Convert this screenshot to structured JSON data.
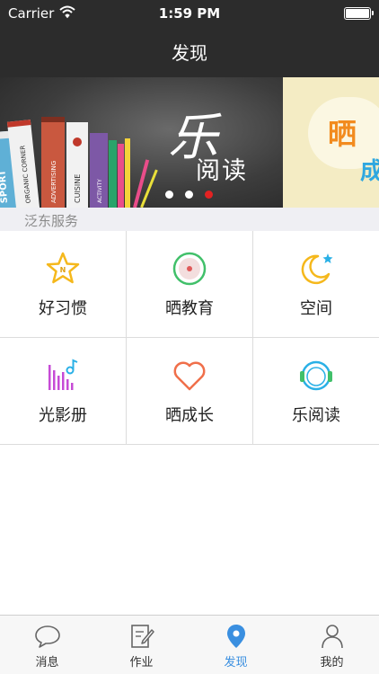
{
  "status_bar": {
    "carrier": "Carrier",
    "time": "1:59 PM"
  },
  "nav": {
    "title": "发现"
  },
  "banner": {
    "main_brush": "乐",
    "main_sub": "阅读",
    "next_text_1": "晒",
    "next_text_2": "成",
    "book_spines": [
      "SPORT",
      "ORGANIC CORNER",
      "ADVERTISING",
      "CUISINE",
      "ACTIVITY"
    ],
    "dots_active_index": 2
  },
  "section": {
    "title": "泛东服务"
  },
  "services": [
    {
      "label": "好习惯",
      "icon": "star-icon"
    },
    {
      "label": "晒教育",
      "icon": "record-icon"
    },
    {
      "label": "空间",
      "icon": "moon-star-icon"
    },
    {
      "label": "光影册",
      "icon": "music-bars-icon"
    },
    {
      "label": "晒成长",
      "icon": "heart-icon"
    },
    {
      "label": "乐阅读",
      "icon": "headphones-icon"
    }
  ],
  "tabs": [
    {
      "label": "消息",
      "icon": "chat-bubble-icon",
      "active": false
    },
    {
      "label": "作业",
      "icon": "edit-document-icon",
      "active": false
    },
    {
      "label": "发现",
      "icon": "location-pin-icon",
      "active": true
    },
    {
      "label": "我的",
      "icon": "person-icon",
      "active": false
    }
  ],
  "colors": {
    "nav_bg": "#2c2c2c",
    "accent_tab": "#3a8fe0",
    "star": "#f5b81c",
    "record": "#41c06a",
    "moon": "#f5b81c",
    "music": "#c64bd6",
    "heart": "#f06f4a",
    "headphones": "#2ab0e6"
  }
}
